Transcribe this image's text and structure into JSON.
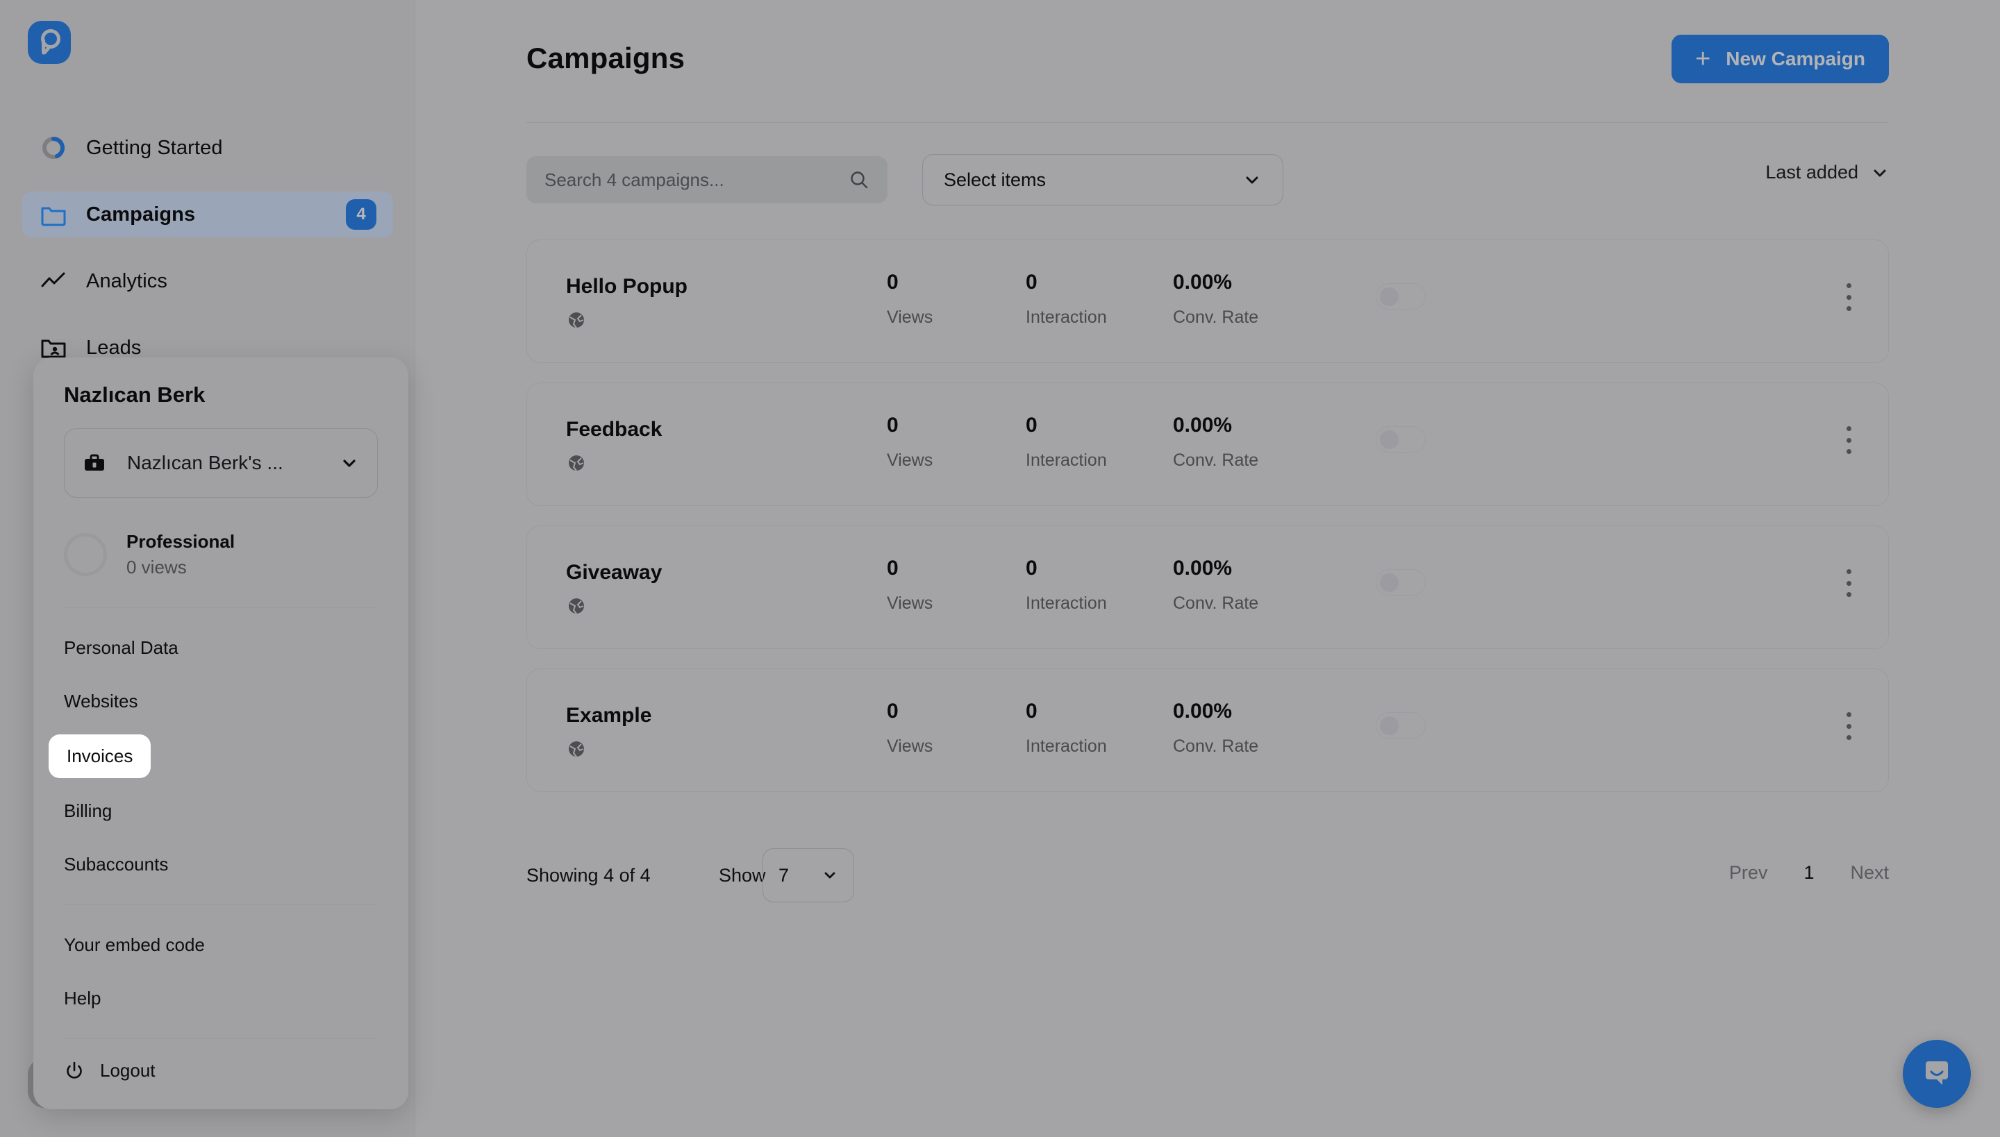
{
  "brand": {
    "logo_icon": "popupsmart-p-logo-icon",
    "primary_color": "#1f5fab"
  },
  "sidebar": {
    "items": [
      {
        "label": "Getting Started",
        "icon": "progress-ring-icon",
        "active": false,
        "badge": null
      },
      {
        "label": "Campaigns",
        "icon": "folder-icon",
        "active": true,
        "badge": "4"
      },
      {
        "label": "Analytics",
        "icon": "line-chart-icon",
        "active": false,
        "badge": null
      },
      {
        "label": "Leads",
        "icon": "folder-user-icon",
        "active": false,
        "badge": null
      }
    ],
    "account": {
      "name": "Nazlıcan Berk",
      "organization": "Nazlıcan Berk's Organization",
      "avatar_icon": "briefcase-icon"
    }
  },
  "account_popup": {
    "title": "Nazlıcan Berk",
    "org_selector": {
      "icon": "briefcase-icon",
      "value": "Nazlıcan Berk's ...",
      "chevron_icon": "chevron-down-icon"
    },
    "plan": {
      "name": "Professional",
      "usage": "0 views",
      "ring_icon": "usage-ring-icon"
    },
    "group_one": [
      {
        "label": "Personal Data",
        "highlight": false
      },
      {
        "label": "Websites",
        "highlight": false
      },
      {
        "label": "Invoices",
        "highlight": true
      },
      {
        "label": "Billing",
        "highlight": false
      },
      {
        "label": "Subaccounts",
        "highlight": false
      }
    ],
    "group_two": [
      {
        "label": "Your embed code",
        "highlight": false
      },
      {
        "label": "Help",
        "highlight": false
      }
    ],
    "logout": {
      "label": "Logout",
      "icon": "power-icon"
    }
  },
  "header": {
    "title": "Campaigns",
    "new_campaign_label": "New Campaign",
    "new_campaign_icon": "plus-icon"
  },
  "toolbar": {
    "search_placeholder": "Search 4 campaigns...",
    "search_value": "",
    "search_icon": "search-icon",
    "select_items_label": "Select items",
    "select_items_chevron": "chevron-down-icon",
    "sort_label": "Last added",
    "sort_chevron": "chevron-down-icon"
  },
  "campaign_columns": {
    "views": "Views",
    "interaction": "Interaction",
    "conv_rate": "Conv. Rate"
  },
  "campaigns": [
    {
      "name": "Hello Popup",
      "platform_icon": "globe-icon",
      "views": "0",
      "interaction": "0",
      "conv_rate": "0.00%",
      "enabled": false
    },
    {
      "name": "Feedback",
      "platform_icon": "globe-icon",
      "views": "0",
      "interaction": "0",
      "conv_rate": "0.00%",
      "enabled": false
    },
    {
      "name": "Giveaway",
      "platform_icon": "globe-icon",
      "views": "0",
      "interaction": "0",
      "conv_rate": "0.00%",
      "enabled": false
    },
    {
      "name": "Example",
      "platform_icon": "globe-icon",
      "views": "0",
      "interaction": "0",
      "conv_rate": "0.00%",
      "enabled": false
    }
  ],
  "footer": {
    "showing": "Showing 4 of 4",
    "show_label": "Show",
    "page_size": "7",
    "page_size_chevron": "chevron-down-icon",
    "prev": "Prev",
    "current_page": "1",
    "next": "Next"
  },
  "chat": {
    "icon": "chat-smile-icon"
  }
}
